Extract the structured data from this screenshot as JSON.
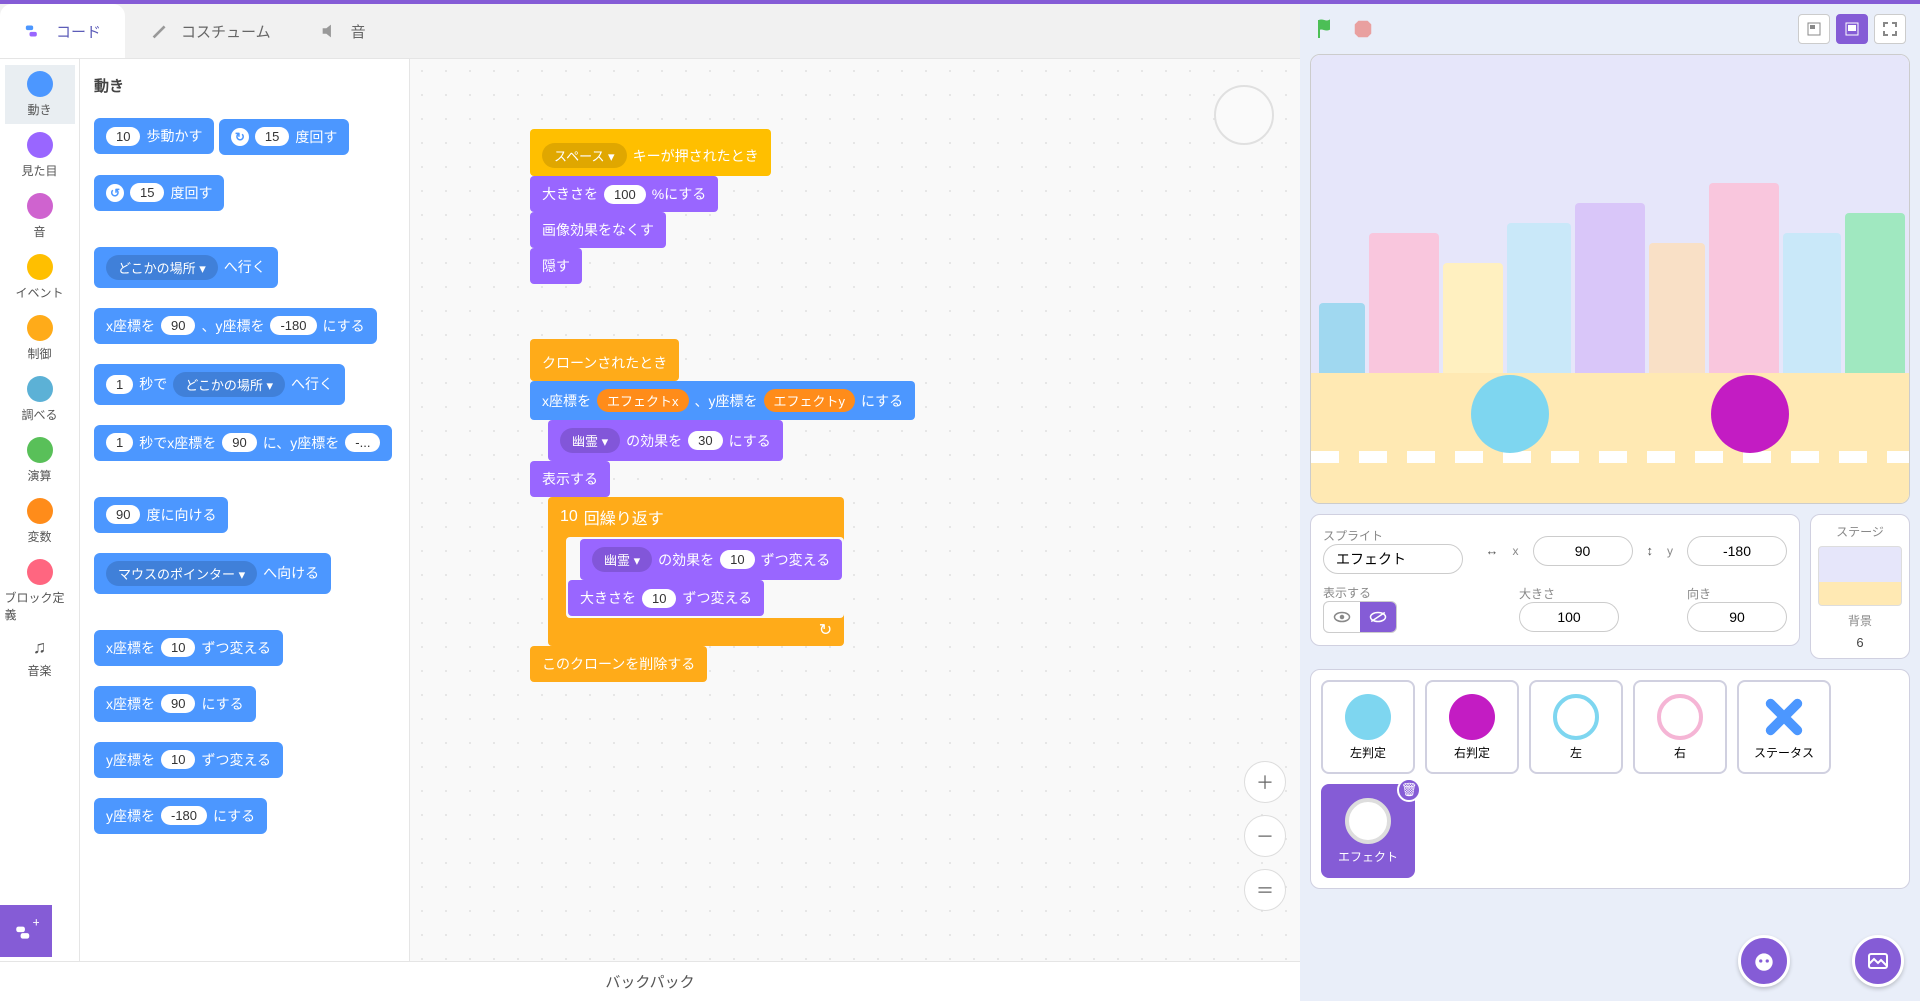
{
  "tabs": {
    "code": "コード",
    "costumes": "コスチューム",
    "sounds": "音"
  },
  "categories": [
    {
      "name": "動き",
      "color": "#4c97ff"
    },
    {
      "name": "見た目",
      "color": "#9966ff"
    },
    {
      "name": "音",
      "color": "#cf63cf"
    },
    {
      "name": "イベント",
      "color": "#ffbf00"
    },
    {
      "name": "制御",
      "color": "#ffab19"
    },
    {
      "name": "調べる",
      "color": "#5cb1d6"
    },
    {
      "name": "演算",
      "color": "#59c059"
    },
    {
      "name": "変数",
      "color": "#ff8c1a"
    },
    {
      "name": "ブロック定義",
      "color": "#ff6680"
    },
    {
      "name": "音楽",
      "color": "#888",
      "note": true
    }
  ],
  "palette_header": "動き",
  "palette_blocks": {
    "move_steps": {
      "pre": "",
      "val": "10",
      "post": "歩動かす"
    },
    "turn_cw": {
      "val": "15",
      "post": "度回す"
    },
    "turn_ccw": {
      "val": "15",
      "post": "度回す"
    },
    "goto_menu": {
      "drop": "どこかの場所 ▾",
      "post": "へ行く"
    },
    "goto_xy": {
      "pre": "x座標を",
      "x": "90",
      "mid": "、y座標を",
      "y": "-180",
      "post": "にする"
    },
    "glide_menu": {
      "secs": "1",
      "mid": "秒で",
      "drop": "どこかの場所 ▾",
      "post": "へ行く"
    },
    "glide_xy": {
      "secs": "1",
      "mid": "秒でx座標を",
      "x": "90",
      "mid2": "に、y座標を",
      "y": "-..."
    },
    "point_dir": {
      "val": "90",
      "post": "度に向ける"
    },
    "point_towards": {
      "drop": "マウスのポインター ▾",
      "post": "へ向ける"
    },
    "change_x": {
      "pre": "x座標を",
      "val": "10",
      "post": "ずつ変える"
    },
    "set_x": {
      "pre": "x座標を",
      "val": "90",
      "post": "にする"
    },
    "change_y": {
      "pre": "y座標を",
      "val": "10",
      "post": "ずつ変える"
    },
    "set_y": {
      "pre": "y座標を",
      "val": "-180",
      "post": "にする"
    }
  },
  "script1": {
    "hat": {
      "drop": "スペース ▾",
      "post": "キーが押されたとき"
    },
    "set_size": {
      "pre": "大きさを",
      "val": "100",
      "post": "%にする"
    },
    "clear_effects": "画像効果をなくす",
    "hide": "隠す"
  },
  "script2": {
    "hat": "クローンされたとき",
    "goto_xy": {
      "pre": "x座標を",
      "x": "エフェクトx",
      "mid": "、y座標を",
      "y": "エフェクトy",
      "post": "にする"
    },
    "set_effect": {
      "drop": "幽霊 ▾",
      "mid": "の効果を",
      "val": "30",
      "post": "にする"
    },
    "show": "表示する",
    "repeat": {
      "val": "10",
      "post": "回繰り返す"
    },
    "change_effect": {
      "drop": "幽霊 ▾",
      "mid": "の効果を",
      "val": "10",
      "post": "ずつ変える"
    },
    "change_size": {
      "pre": "大きさを",
      "val": "10",
      "post": "ずつ変える"
    },
    "delete_clone": "このクローンを削除する"
  },
  "backpack": "バックパック",
  "sprite_info": {
    "label_sprite": "スプライト",
    "name": "エフェクト",
    "x_label": "x",
    "x": "90",
    "y_label": "y",
    "y": "-180",
    "show_label": "表示する",
    "size_label": "大きさ",
    "size": "100",
    "direction_label": "向き",
    "direction": "90"
  },
  "stage_selector": {
    "label": "ステージ",
    "backdrops_label": "背景",
    "count": "6"
  },
  "sprites": [
    {
      "label": "左判定",
      "fill": "#7ed6f0",
      "stroke": "none"
    },
    {
      "label": "右判定",
      "fill": "#c31cc3",
      "stroke": "none"
    },
    {
      "label": "左",
      "fill": "#fff",
      "stroke": "#7ed6f0"
    },
    {
      "label": "右",
      "fill": "#fff",
      "stroke": "#f5b5d5"
    },
    {
      "label": "ステータス",
      "cross": true
    },
    {
      "label": "エフェクト",
      "fill": "#fff",
      "stroke": "#ddd",
      "selected": true
    }
  ]
}
